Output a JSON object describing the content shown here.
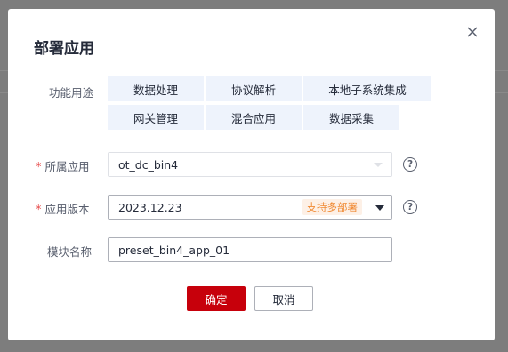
{
  "dialog": {
    "title": "部署应用",
    "close_icon": "close-icon"
  },
  "form": {
    "function_label": "功能用途",
    "function_tags": [
      "数据处理",
      "协议解析",
      "本地子系统集成",
      "网关管理",
      "混合应用",
      "数据采集"
    ],
    "app_label": "所属应用",
    "app_value": "ot_dc_bin4",
    "version_label": "应用版本",
    "version_value": "2023.12.23",
    "version_badge": "支持多部署",
    "module_label": "模块名称",
    "module_value": "preset_bin4_app_01",
    "required_mark": "*",
    "help_glyph": "?"
  },
  "footer": {
    "confirm_label": "确定",
    "cancel_label": "取消"
  },
  "colors": {
    "primary": "#c7000b",
    "tag_bg": "#eef3fc",
    "badge_text": "#f08a34",
    "badge_bg": "#fdf0e6",
    "required": "#e64c4c"
  }
}
